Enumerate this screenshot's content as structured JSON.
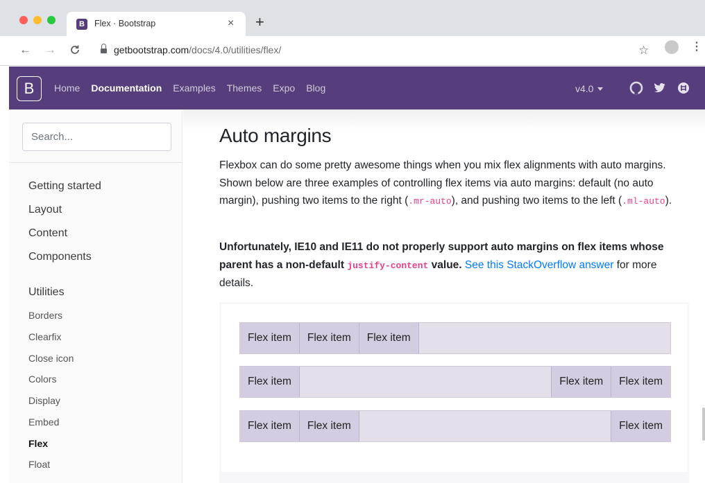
{
  "browser": {
    "tab_title": "Flex · Bootstrap",
    "tab_favicon": "B",
    "tab_close": "×",
    "new_tab": "+",
    "url_host": "getbootstrap.com",
    "url_path": "/docs/4.0/utilities/flex/",
    "back": "←",
    "forward": "→",
    "reload": "C",
    "star": "☆",
    "menu": "⋮",
    "traffic_lights": [
      "#ff5f57",
      "#febc2e",
      "#28c840"
    ]
  },
  "navbar": {
    "brand": "B",
    "links": [
      "Home",
      "Documentation",
      "Examples",
      "Themes",
      "Expo",
      "Blog"
    ],
    "active_link": "Documentation",
    "version": "v4.0",
    "icons": [
      "github-icon",
      "twitter-icon",
      "slack-icon"
    ],
    "color": "#563d7c"
  },
  "sidebar": {
    "search_placeholder": "Search...",
    "groups": [
      "Getting started",
      "Layout",
      "Content",
      "Components",
      "Utilities"
    ],
    "utilities_items": [
      "Borders",
      "Clearfix",
      "Close icon",
      "Colors",
      "Display",
      "Embed",
      "Flex",
      "Float"
    ],
    "active_item": "Flex"
  },
  "content": {
    "title": "Auto margins",
    "p1_text": "Flexbox can do some pretty awesome things when you mix flex alignments with auto margins. Shown below are three examples of controlling flex items via auto margins: default (no auto margin), pushing two items to the right (",
    "p1_code1": ".mr-auto",
    "p1_mid": "), and pushing two items to the left (",
    "p1_code2": ".ml-auto",
    "p1_end": ").",
    "p2_bold1": "Unfortunately, IE10 and IE11 do not properly support auto margins on flex items whose parent has a non-default ",
    "p2_code": "justify-content",
    "p2_bold2": " value.",
    "p2_link": "See this StackOverflow answer",
    "p2_end": " for more details.",
    "flex_item_label": "Flex item"
  }
}
